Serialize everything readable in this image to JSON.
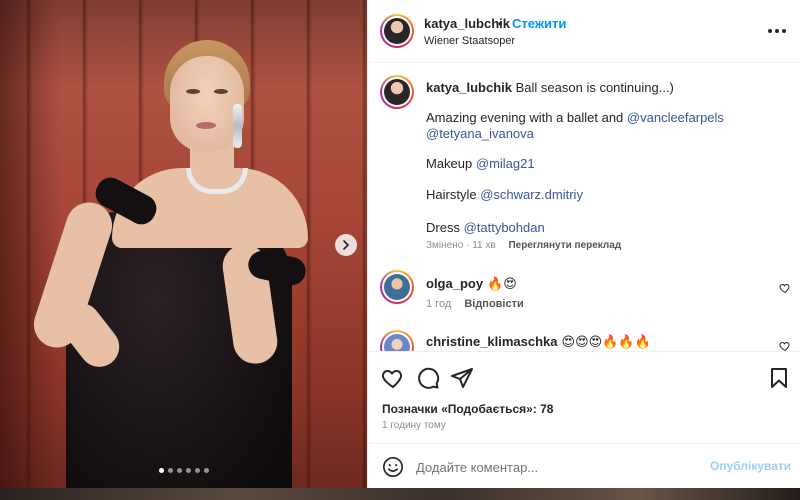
{
  "post": {
    "username": "katya_lubchik",
    "separator": "•",
    "follow_label": "Стежити",
    "location": "Wiener Staatsoper",
    "image_count": 6,
    "active_image": 1
  },
  "caption": {
    "username": "katya_lubchik",
    "line1": "Ball season is continuing...)",
    "line2_prefix": "Amazing evening with a ballet and ",
    "mention_vcap": "@vancleefarpels",
    "mention_tetyana": "@tetyana_ivanova",
    "makeup_label": "Makeup ",
    "mention_makeup": "@milag21",
    "hair_label": "Hairstyle ",
    "mention_hair": "@schwarz.dmitriy",
    "dress_label": "Dress ",
    "mention_dress": "@tattybohdan",
    "edited_time": "Змінено · 11 хв",
    "translate_label": "Переглянути переклад"
  },
  "comments": [
    {
      "username": "olga_poy",
      "text": "🔥😍",
      "time": "1 год",
      "reply_label": "Відповісти"
    },
    {
      "username": "christine_klimaschka",
      "text": "😍😍😍🔥🔥🔥"
    }
  ],
  "actions": {
    "likes": "Позначки «Подобається»: 78",
    "time_ago": "1 годину тому"
  },
  "comment_box": {
    "placeholder": "Додайте коментар...",
    "publish_label": "Опублікувати"
  },
  "colors": {
    "accent": "#0095f6",
    "mention": "#385898",
    "publish_disabled": "#9fcff5"
  }
}
